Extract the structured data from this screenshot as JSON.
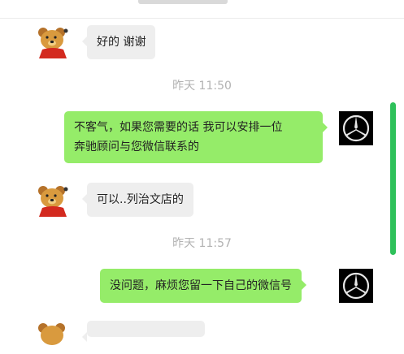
{
  "messages": [
    {
      "from": "contact",
      "text": "好的 谢谢"
    },
    {
      "timestamp": "昨天 11:50"
    },
    {
      "from": "self",
      "lines": [
        "不客气，如果您需要的话 我可以安排一位",
        "奔驰顾问与您微信联系的"
      ]
    },
    {
      "from": "contact",
      "text": "可以..列治文店的"
    },
    {
      "timestamp": "昨天 11:57"
    },
    {
      "from": "self",
      "text": "没问题，麻烦您留一下自己的微信号"
    }
  ],
  "colors": {
    "self_bubble": "#95ec69",
    "contact_bubble": "#eeeeee",
    "timestamp": "#b2b2b2",
    "scrollbar": "#2ec15a"
  },
  "icons": {
    "contact_avatar": "winnie-the-pooh-avatar",
    "self_avatar": "mercedes-benz-logo-avatar"
  }
}
